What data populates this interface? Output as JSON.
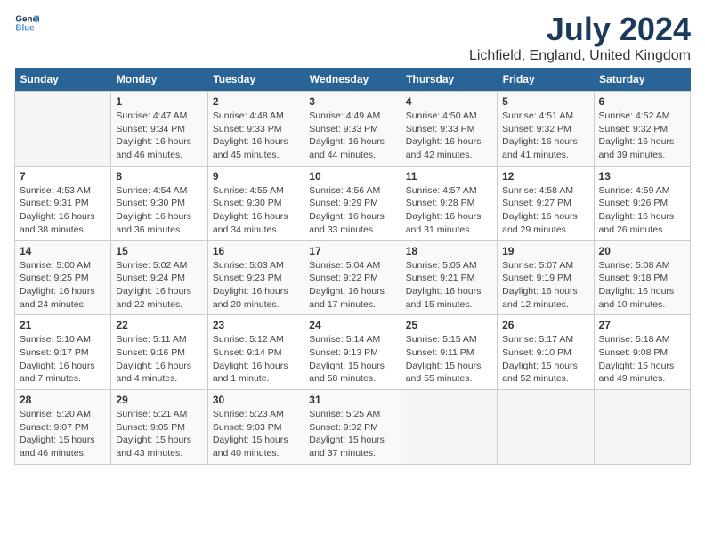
{
  "header": {
    "logo_line1": "General",
    "logo_line2": "Blue",
    "title": "July 2024",
    "subtitle": "Lichfield, England, United Kingdom"
  },
  "columns": [
    "Sunday",
    "Monday",
    "Tuesday",
    "Wednesday",
    "Thursday",
    "Friday",
    "Saturday"
  ],
  "weeks": [
    [
      {
        "day": "",
        "info": ""
      },
      {
        "day": "1",
        "info": "Sunrise: 4:47 AM\nSunset: 9:34 PM\nDaylight: 16 hours\nand 46 minutes."
      },
      {
        "day": "2",
        "info": "Sunrise: 4:48 AM\nSunset: 9:33 PM\nDaylight: 16 hours\nand 45 minutes."
      },
      {
        "day": "3",
        "info": "Sunrise: 4:49 AM\nSunset: 9:33 PM\nDaylight: 16 hours\nand 44 minutes."
      },
      {
        "day": "4",
        "info": "Sunrise: 4:50 AM\nSunset: 9:33 PM\nDaylight: 16 hours\nand 42 minutes."
      },
      {
        "day": "5",
        "info": "Sunrise: 4:51 AM\nSunset: 9:32 PM\nDaylight: 16 hours\nand 41 minutes."
      },
      {
        "day": "6",
        "info": "Sunrise: 4:52 AM\nSunset: 9:32 PM\nDaylight: 16 hours\nand 39 minutes."
      }
    ],
    [
      {
        "day": "7",
        "info": "Sunrise: 4:53 AM\nSunset: 9:31 PM\nDaylight: 16 hours\nand 38 minutes."
      },
      {
        "day": "8",
        "info": "Sunrise: 4:54 AM\nSunset: 9:30 PM\nDaylight: 16 hours\nand 36 minutes."
      },
      {
        "day": "9",
        "info": "Sunrise: 4:55 AM\nSunset: 9:30 PM\nDaylight: 16 hours\nand 34 minutes."
      },
      {
        "day": "10",
        "info": "Sunrise: 4:56 AM\nSunset: 9:29 PM\nDaylight: 16 hours\nand 33 minutes."
      },
      {
        "day": "11",
        "info": "Sunrise: 4:57 AM\nSunset: 9:28 PM\nDaylight: 16 hours\nand 31 minutes."
      },
      {
        "day": "12",
        "info": "Sunrise: 4:58 AM\nSunset: 9:27 PM\nDaylight: 16 hours\nand 29 minutes."
      },
      {
        "day": "13",
        "info": "Sunrise: 4:59 AM\nSunset: 9:26 PM\nDaylight: 16 hours\nand 26 minutes."
      }
    ],
    [
      {
        "day": "14",
        "info": "Sunrise: 5:00 AM\nSunset: 9:25 PM\nDaylight: 16 hours\nand 24 minutes."
      },
      {
        "day": "15",
        "info": "Sunrise: 5:02 AM\nSunset: 9:24 PM\nDaylight: 16 hours\nand 22 minutes."
      },
      {
        "day": "16",
        "info": "Sunrise: 5:03 AM\nSunset: 9:23 PM\nDaylight: 16 hours\nand 20 minutes."
      },
      {
        "day": "17",
        "info": "Sunrise: 5:04 AM\nSunset: 9:22 PM\nDaylight: 16 hours\nand 17 minutes."
      },
      {
        "day": "18",
        "info": "Sunrise: 5:05 AM\nSunset: 9:21 PM\nDaylight: 16 hours\nand 15 minutes."
      },
      {
        "day": "19",
        "info": "Sunrise: 5:07 AM\nSunset: 9:19 PM\nDaylight: 16 hours\nand 12 minutes."
      },
      {
        "day": "20",
        "info": "Sunrise: 5:08 AM\nSunset: 9:18 PM\nDaylight: 16 hours\nand 10 minutes."
      }
    ],
    [
      {
        "day": "21",
        "info": "Sunrise: 5:10 AM\nSunset: 9:17 PM\nDaylight: 16 hours\nand 7 minutes."
      },
      {
        "day": "22",
        "info": "Sunrise: 5:11 AM\nSunset: 9:16 PM\nDaylight: 16 hours\nand 4 minutes."
      },
      {
        "day": "23",
        "info": "Sunrise: 5:12 AM\nSunset: 9:14 PM\nDaylight: 16 hours\nand 1 minute."
      },
      {
        "day": "24",
        "info": "Sunrise: 5:14 AM\nSunset: 9:13 PM\nDaylight: 15 hours\nand 58 minutes."
      },
      {
        "day": "25",
        "info": "Sunrise: 5:15 AM\nSunset: 9:11 PM\nDaylight: 15 hours\nand 55 minutes."
      },
      {
        "day": "26",
        "info": "Sunrise: 5:17 AM\nSunset: 9:10 PM\nDaylight: 15 hours\nand 52 minutes."
      },
      {
        "day": "27",
        "info": "Sunrise: 5:18 AM\nSunset: 9:08 PM\nDaylight: 15 hours\nand 49 minutes."
      }
    ],
    [
      {
        "day": "28",
        "info": "Sunrise: 5:20 AM\nSunset: 9:07 PM\nDaylight: 15 hours\nand 46 minutes."
      },
      {
        "day": "29",
        "info": "Sunrise: 5:21 AM\nSunset: 9:05 PM\nDaylight: 15 hours\nand 43 minutes."
      },
      {
        "day": "30",
        "info": "Sunrise: 5:23 AM\nSunset: 9:03 PM\nDaylight: 15 hours\nand 40 minutes."
      },
      {
        "day": "31",
        "info": "Sunrise: 5:25 AM\nSunset: 9:02 PM\nDaylight: 15 hours\nand 37 minutes."
      },
      {
        "day": "",
        "info": ""
      },
      {
        "day": "",
        "info": ""
      },
      {
        "day": "",
        "info": ""
      }
    ]
  ]
}
